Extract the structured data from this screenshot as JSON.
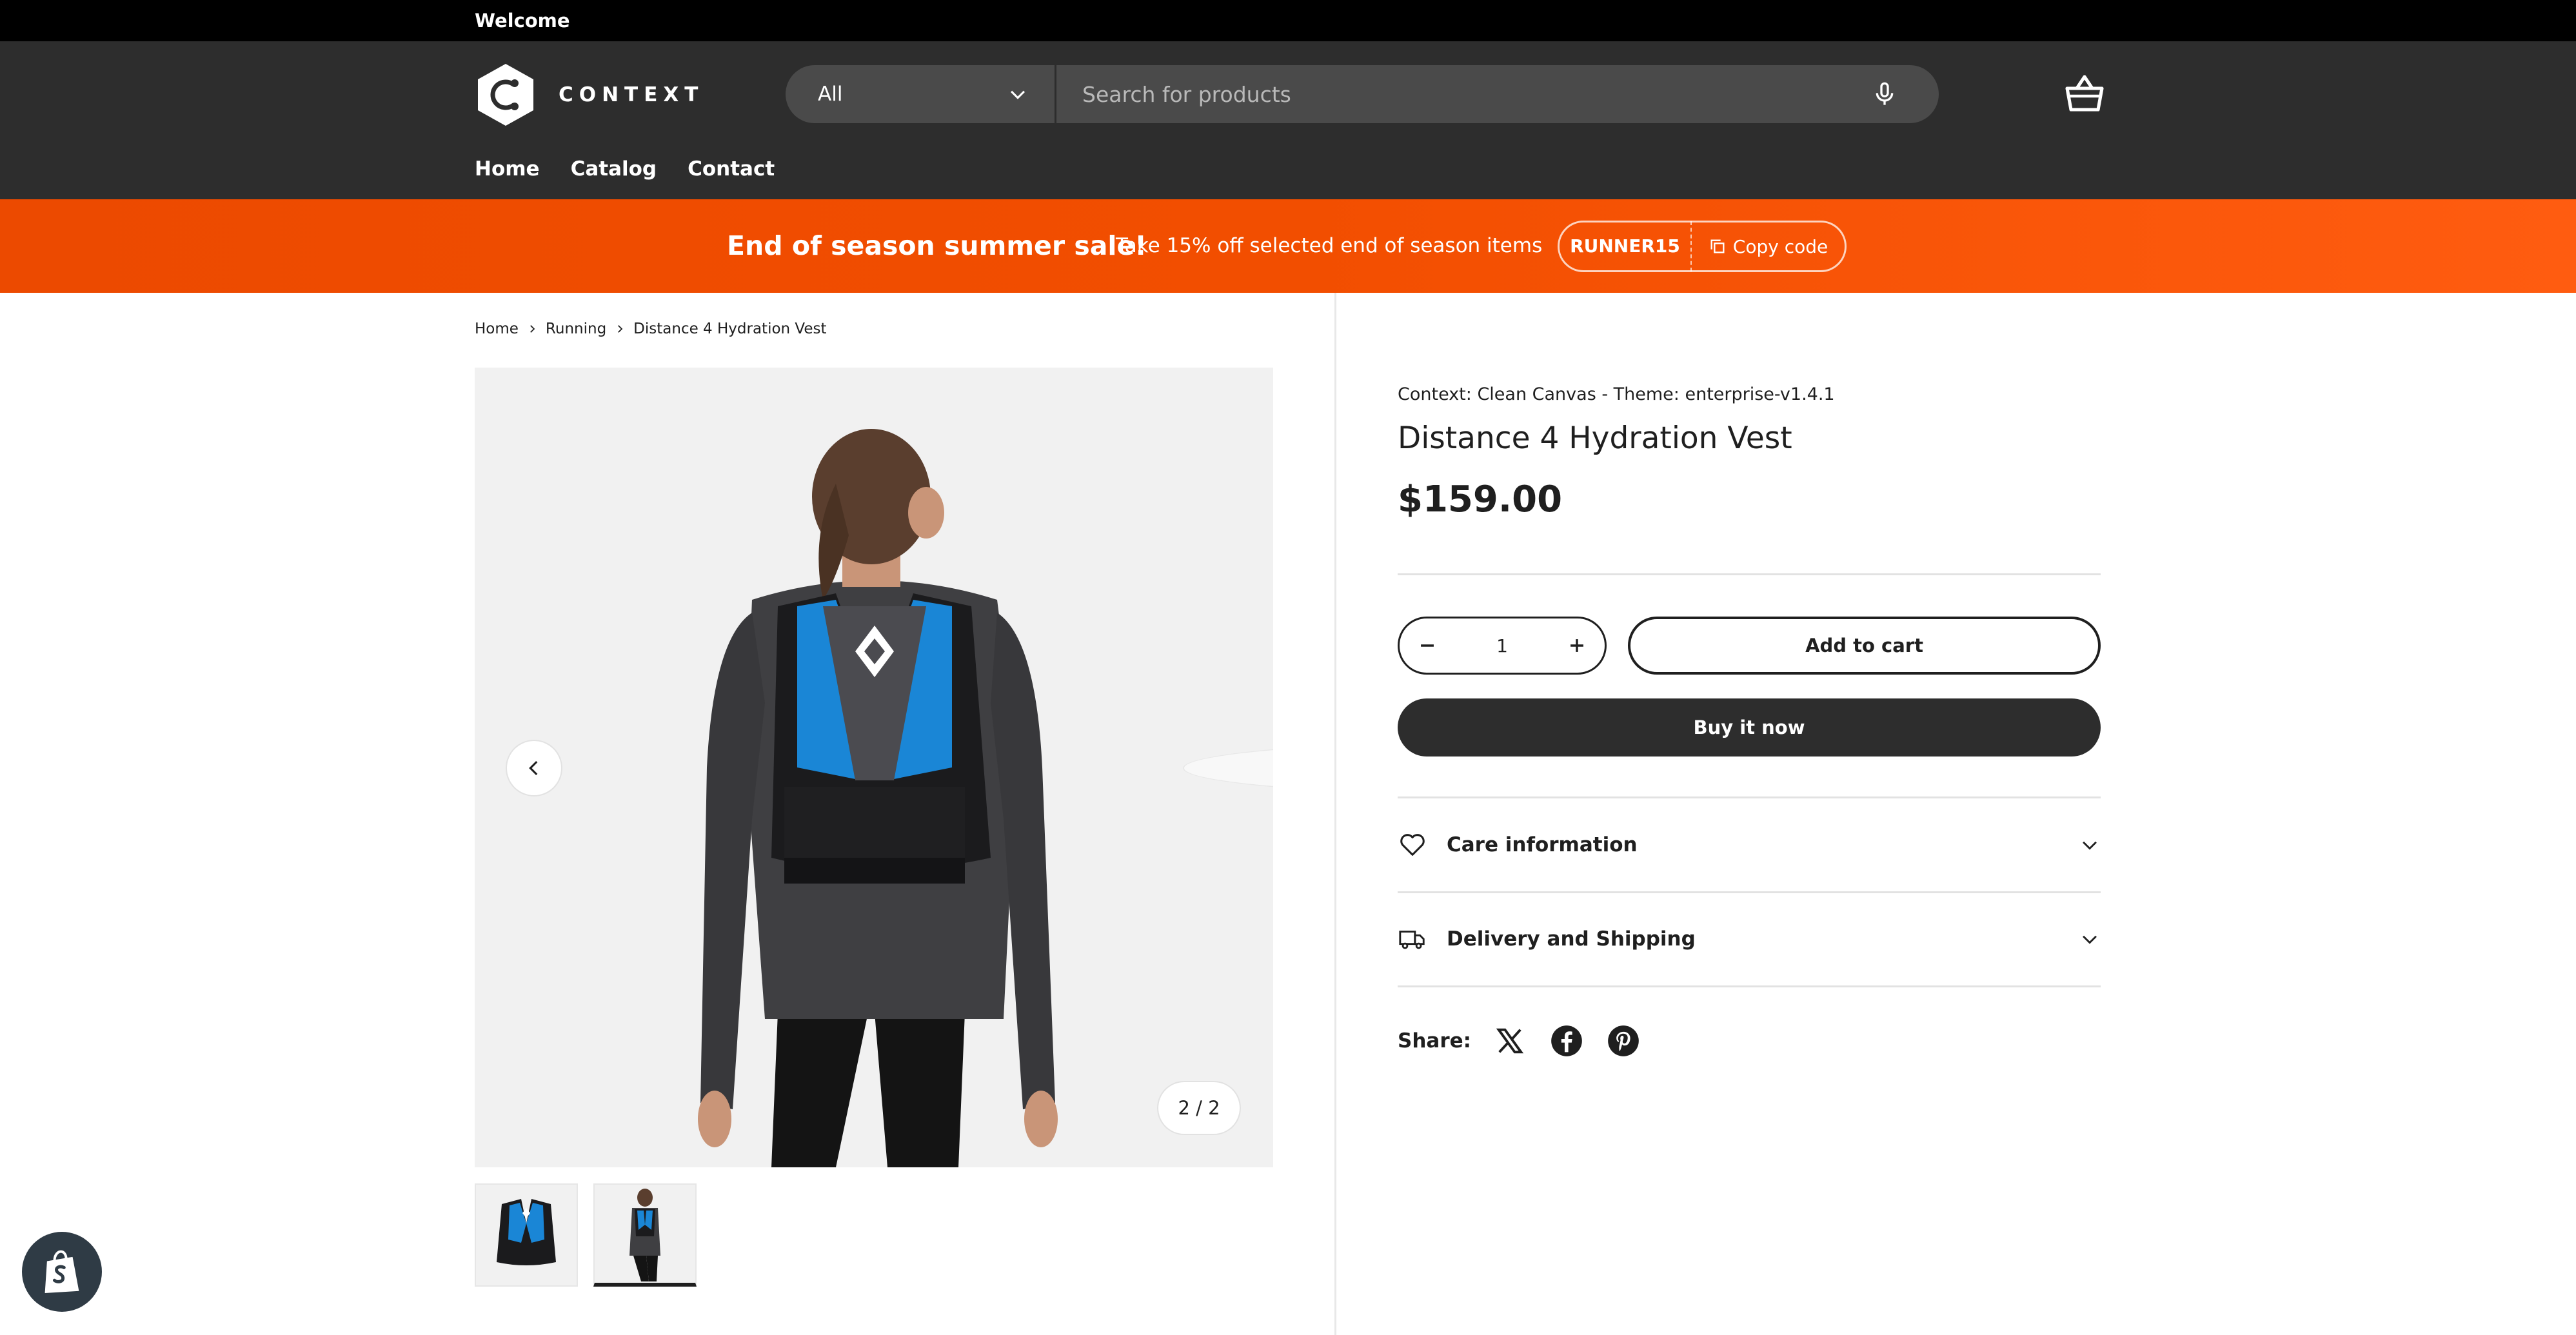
{
  "topbar": {
    "welcome": "Welcome"
  },
  "header": {
    "logo_text": "CONTEXT",
    "search": {
      "category": "All",
      "placeholder": "Search for products"
    },
    "nav": [
      "Home",
      "Catalog",
      "Contact"
    ]
  },
  "promo": {
    "headline": "End of season summer sale!",
    "sub": "Take 15% off selected end of season items",
    "code": "RUNNER15",
    "copy_label": "Copy code",
    "colors": {
      "start": "#ec4a00",
      "end": "#ff5c10"
    }
  },
  "breadcrumb": [
    "Home",
    "Running",
    "Distance 4 Hydration Vest"
  ],
  "gallery": {
    "counter": "2 / 2"
  },
  "product": {
    "vendor": "Context: Clean Canvas - Theme: enterprise-v1.4.1",
    "title": "Distance 4 Hydration Vest",
    "price": "$159.00",
    "quantity": "1",
    "add_to_cart": "Add to cart",
    "buy_now": "Buy it now",
    "accordions": [
      {
        "label": "Care information",
        "icon": "heart-icon"
      },
      {
        "label": "Delivery and Shipping",
        "icon": "truck-icon"
      }
    ],
    "share_label": "Share:",
    "share_icons": [
      "x-icon",
      "facebook-icon",
      "pinterest-icon"
    ]
  },
  "colors": {
    "header_bg": "#2d2d2d",
    "topbar_bg": "#000000",
    "button_dark": "#2d2d2d",
    "accent_vest": "#1a86d6"
  }
}
